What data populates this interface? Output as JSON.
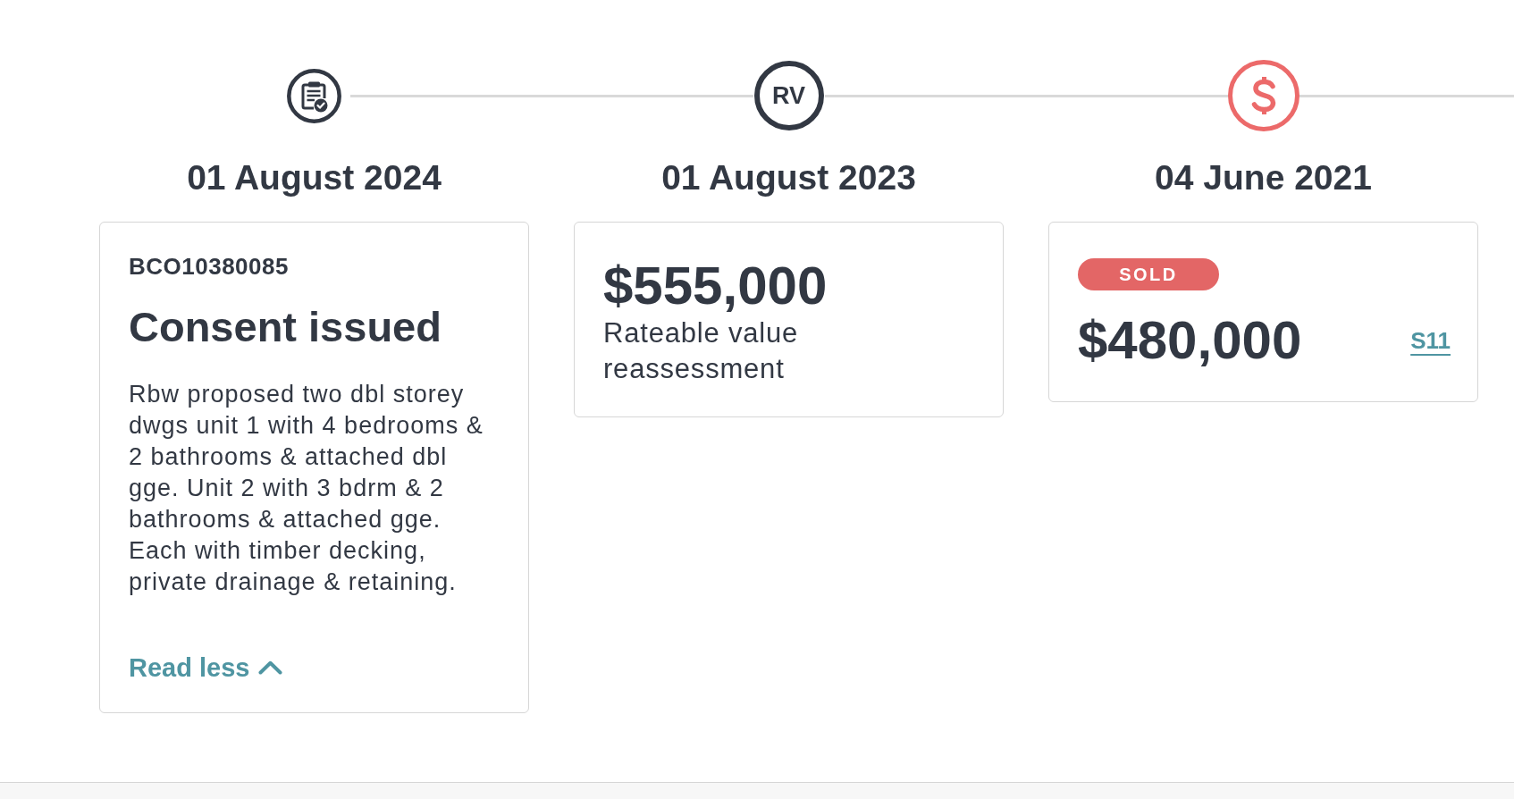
{
  "timeline": [
    {
      "date": "01 August 2024",
      "marker": {
        "kind": "clipboard",
        "color": "#323843"
      },
      "card": {
        "kind": "consent",
        "reference": "BCO10380085",
        "title": "Consent issued",
        "description": "Rbw proposed two dbl storey dwgs unit 1 with 4 bedrooms & 2 bathrooms & attached dbl gge. Unit 2 with 3 bdrm & 2 bathrooms & attached gge. Each with timber decking, private drainage & retaining.",
        "toggle": {
          "label": "Read less",
          "expanded": true
        }
      }
    },
    {
      "date": "01 August 2023",
      "marker": {
        "kind": "text",
        "text": "RV",
        "color": "#323843"
      },
      "card": {
        "kind": "valuation",
        "amount": "$555,000",
        "label": "Rateable value reassessment"
      }
    },
    {
      "date": "04 June 2021",
      "marker": {
        "kind": "dollar",
        "color": "#ec6a6a"
      },
      "card": {
        "kind": "sale",
        "badge": "SOLD",
        "amount": "$480,000",
        "link": "S11"
      }
    }
  ]
}
